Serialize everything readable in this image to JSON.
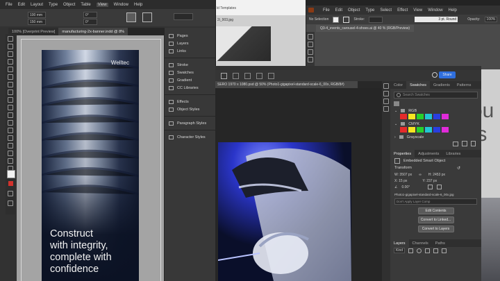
{
  "indesign": {
    "menu": [
      "File",
      "Edit",
      "Layout",
      "Type",
      "Object",
      "Table",
      "View",
      "Window",
      "Help"
    ],
    "field_values": [
      "100 mm",
      "150 mm",
      "0°",
      "0°"
    ],
    "doc_tabs": [
      "100% [Overprint Preview]",
      "manufacturing-2x-banner.indd @ 8%"
    ],
    "banner": {
      "brand": "Welltec",
      "line1": "Construct",
      "line2": "with integrity,",
      "line3": "complete with",
      "line4": "confidence"
    },
    "panels": {
      "group1": [
        "Pages",
        "Layers",
        "Links"
      ],
      "group2": [
        "Stroke",
        "Swatches",
        "Gradient",
        "CC Libraries"
      ],
      "group3": [
        "Effects",
        "Object Styles"
      ],
      "group4": [
        "Paragraph Styles"
      ],
      "group5": [
        "Character Styles"
      ]
    }
  },
  "background_window": {
    "title_fragment": "ld Templates",
    "file_fragment": "2i_903.jpg",
    "doc_title": "SERO 1970 x 1080.psd @ 50% (Photo1-gigapixel-standard-scale-6_00x, RGB/8#)"
  },
  "illustrator": {
    "menu": [
      "File",
      "Edit",
      "Object",
      "Type",
      "Select",
      "Effect",
      "View",
      "Window",
      "Help"
    ],
    "control": {
      "selection": "No Selection",
      "stroke_label": "Stroke:",
      "brush": "3 pt. Round",
      "opacity_label": "Opacity:",
      "opacity_value": "100%"
    },
    "doc_tab": "Q3-4_events_carousel-4-shoes.ai @ 40 % (RGB/Preview)"
  },
  "photoshop": {
    "share_label": "Share",
    "tabs": [
      "Color",
      "Swatches",
      "Gradients",
      "Patterns"
    ],
    "search_placeholder": "Search Swatches",
    "swatch_groups": [
      "RGB",
      "CMYK",
      "Grayscale"
    ],
    "colors": {
      "rgb": [
        "#e52b2b",
        "#f5e521",
        "#27d12c",
        "#22c6d4",
        "#2a3ee0",
        "#e02bd9"
      ],
      "cmyk": [
        "#e52b2b",
        "#f5e521",
        "#27d12c",
        "#22c6d4",
        "#2a3ee0",
        "#e02bd9"
      ],
      "gray": [
        "#3f3f3f",
        "#6f6f6f",
        "#9f9f9f",
        "#d0d0d0"
      ]
    },
    "properties": {
      "tabs": [
        "Properties",
        "Adjustments",
        "Libraries"
      ],
      "object_type": "Embedded Smart Object",
      "section": "Transform",
      "w_label": "W:",
      "w_value": "3507 px",
      "h_label": "H:",
      "h_value": "2453 px",
      "x_label": "X:",
      "x_value": "15 px",
      "y_label": "Y:",
      "y_value": "237 px",
      "angle": "0.00°",
      "filename": "Photo1-gigapixel-standard-scale-6_00x.jpg",
      "layer_comp": "Don't Apply Layer Comp",
      "buttons": [
        "Edit Contents",
        "Convert to Linked...",
        "Convert to Layers"
      ]
    },
    "layers": {
      "tabs": [
        "Layers",
        "Channels",
        "Paths"
      ],
      "kind_label": "Kind"
    }
  },
  "right_preview": {
    "big_text_1": "ou",
    "big_text_2": "ts"
  }
}
